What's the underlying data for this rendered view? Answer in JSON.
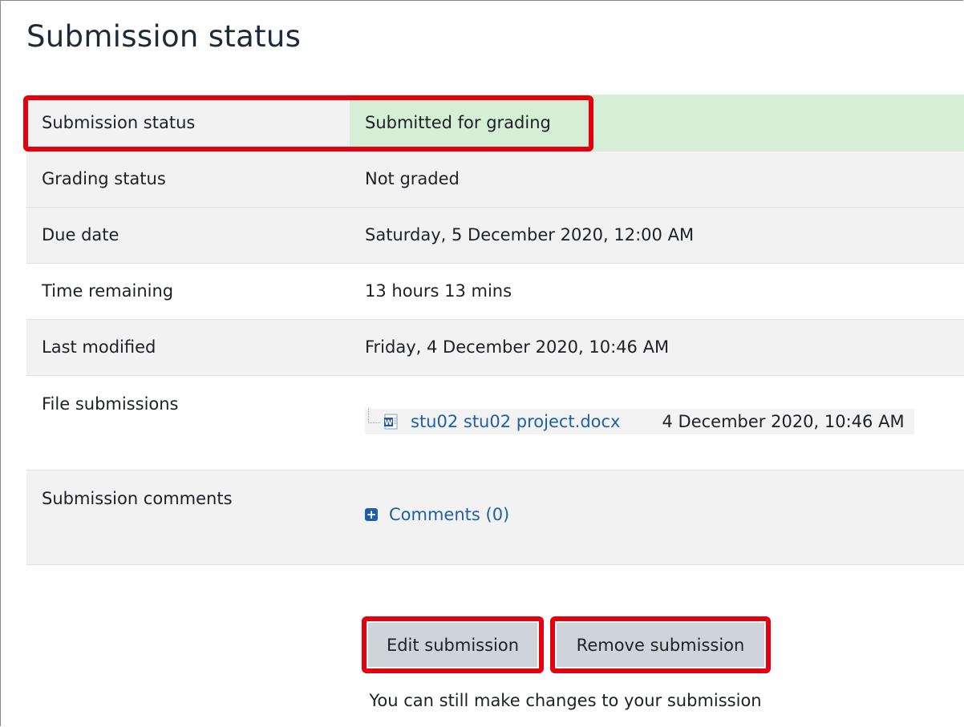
{
  "page": {
    "title": "Submission status"
  },
  "rows": {
    "submission_status": {
      "label": "Submission status",
      "value": "Submitted for grading"
    },
    "grading_status": {
      "label": "Grading status",
      "value": "Not graded"
    },
    "due_date": {
      "label": "Due date",
      "value": "Saturday, 5 December 2020, 12:00 AM"
    },
    "time_remaining": {
      "label": "Time remaining",
      "value": "13 hours 13 mins"
    },
    "last_modified": {
      "label": "Last modified",
      "value": "Friday, 4 December 2020, 10:46 AM"
    },
    "file_submissions": {
      "label": "File submissions",
      "file_name": "stu02 stu02 project.docx",
      "file_date": "4 December 2020, 10:46 AM",
      "file_icon": "word-document-icon"
    },
    "submission_comments": {
      "label": "Submission comments",
      "link": "Comments (0)",
      "icon": "plus-square-icon"
    }
  },
  "actions": {
    "edit_label": "Edit submission",
    "remove_label": "Remove submission",
    "hint": "You can still make changes to your submission"
  },
  "colors": {
    "submitted_bg": "#d5efd7",
    "highlight": "#e4000f",
    "link": "#1f5fa8",
    "button_bg": "#ced4da"
  }
}
